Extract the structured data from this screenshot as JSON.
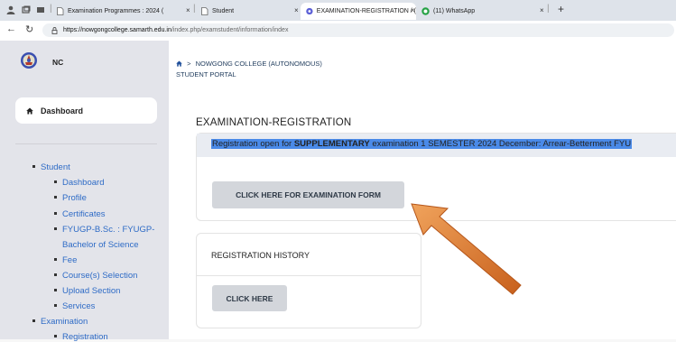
{
  "browser": {
    "tabs": [
      {
        "label": "Examination Programmes : 2024 (",
        "icon": "document-icon"
      },
      {
        "label": "Student",
        "icon": "document-icon"
      },
      {
        "label": "EXAMINATION-REGISTRATION / (",
        "icon": "samarth-icon"
      },
      {
        "label": "(11) WhatsApp",
        "icon": "whatsapp-icon"
      }
    ],
    "new_tab": "+",
    "close": "×",
    "url_host": "https://nowgongcollege.samarth.edu.in",
    "url_path": "/index.php/examstudent/information/index"
  },
  "sidebar": {
    "brand": "NC",
    "dashboard_label": "Dashboard",
    "nav": {
      "student": "Student",
      "dashboard": "Dashboard",
      "profile": "Profile",
      "certificates": "Certificates",
      "program_1": "FYUGP-B.Sc. : FYUGP-",
      "program_2": "Bachelor of Science",
      "fee": "Fee",
      "course_selection": "Course(s) Selection",
      "upload_section": "Upload Section",
      "services": "Services",
      "examination": "Examination",
      "registration": "Registration"
    }
  },
  "header": {
    "college": "NOWGONG COLLEGE (AUTONOMOUS)",
    "portal": "STUDENT PORTAL",
    "separator": ">"
  },
  "main": {
    "title": "EXAMINATION-REGISTRATION",
    "notice_prefix": "Registration open for ",
    "notice_bold": "SUPPLEMENTARY",
    "notice_suffix": " examination 1 SEMESTER 2024 December: Arrear-Betterment FYU",
    "exam_form_button": "CLICK HERE FOR EXAMINATION FORM",
    "history_title": "REGISTRATION HISTORY",
    "history_button": "CLICK HERE"
  },
  "colors": {
    "highlight": "#4a8ae8",
    "nav_link": "#2e6bc6",
    "arrow": "#e07a2e"
  }
}
